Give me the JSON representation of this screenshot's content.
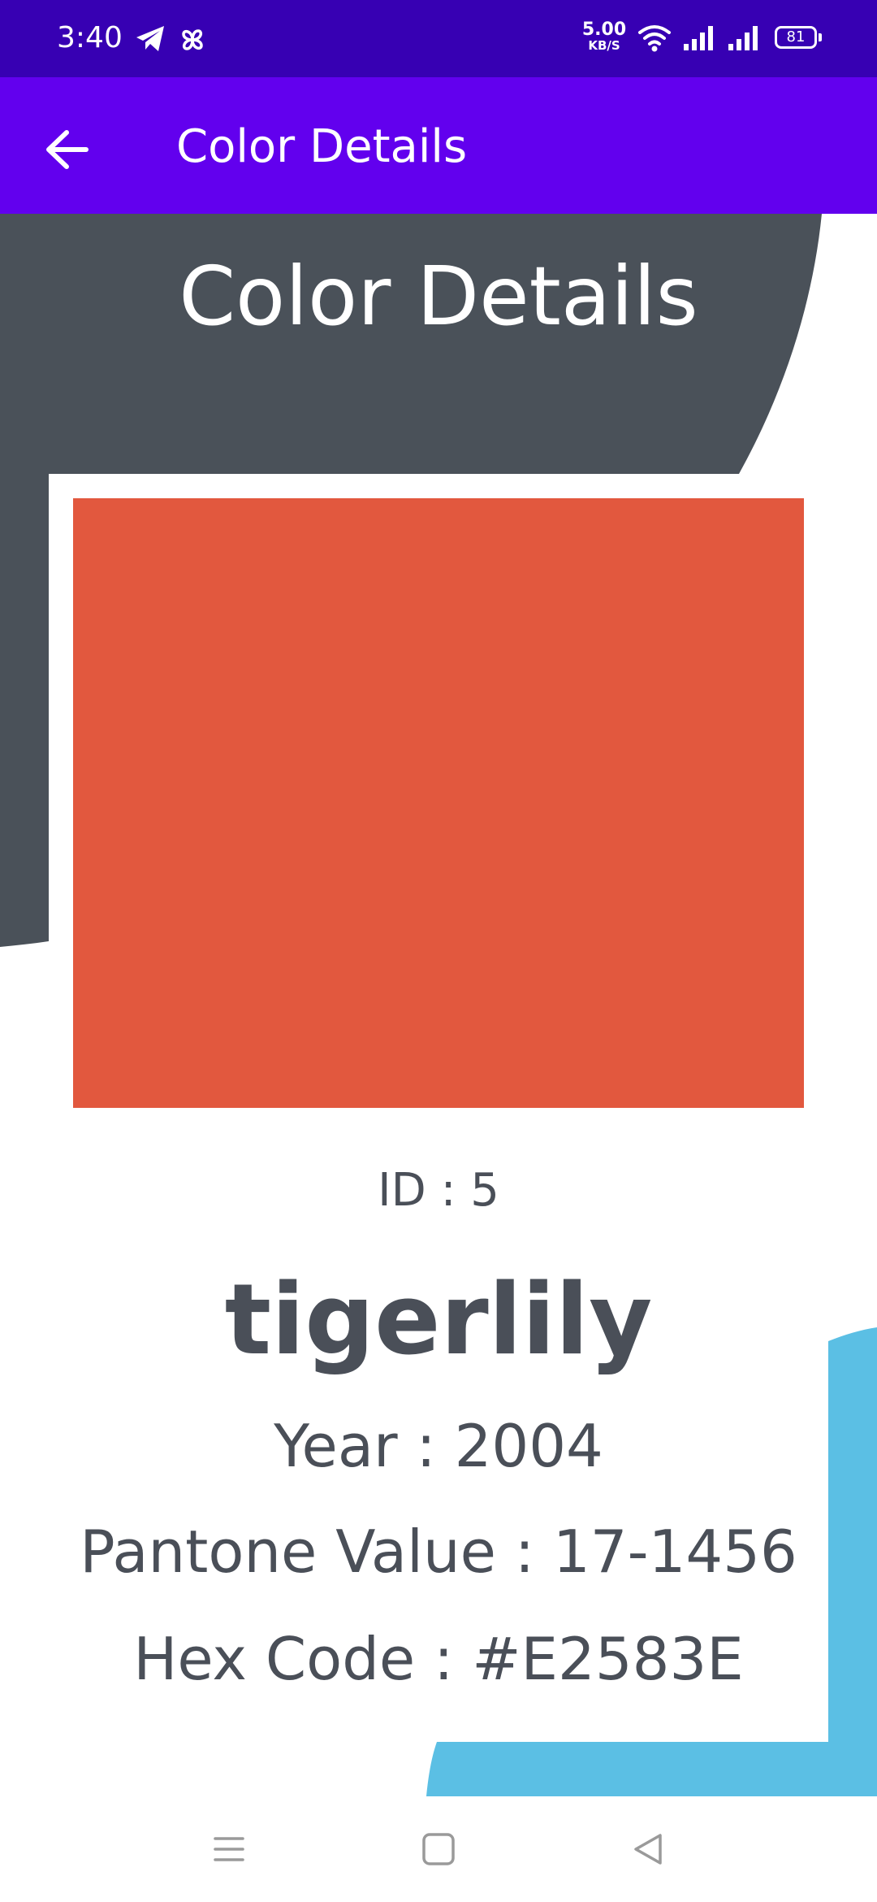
{
  "status_bar": {
    "time": "3:40",
    "net_speed_value": "5.00",
    "net_speed_unit": "KB/S",
    "battery": "81",
    "icons": [
      "telegram-icon",
      "pinwheel-icon",
      "wifi-icon",
      "signal-icon",
      "signal-icon",
      "battery-icon"
    ]
  },
  "app_bar": {
    "title": "Color Details",
    "back_icon": "arrow-left-icon"
  },
  "page": {
    "heading": "Color Details"
  },
  "color": {
    "swatch_hex": "#E2583E",
    "id_text": "ID : 5",
    "name": "tigerlily",
    "year_text": "Year : 2004",
    "pantone_text": "Pantone Value : 17-1456",
    "hex_text": "Hex Code : #E2583E"
  },
  "decorations": {
    "dark_shape_color": "#4A5159",
    "blue_shape_color": "#5BBFE4"
  },
  "nav_bar": {
    "buttons": [
      "menu-icon",
      "home-icon",
      "back-triangle-icon"
    ]
  },
  "colors": {
    "status_bar": "#3700B3",
    "app_bar": "#6200EE",
    "text": "#4A4F58"
  }
}
